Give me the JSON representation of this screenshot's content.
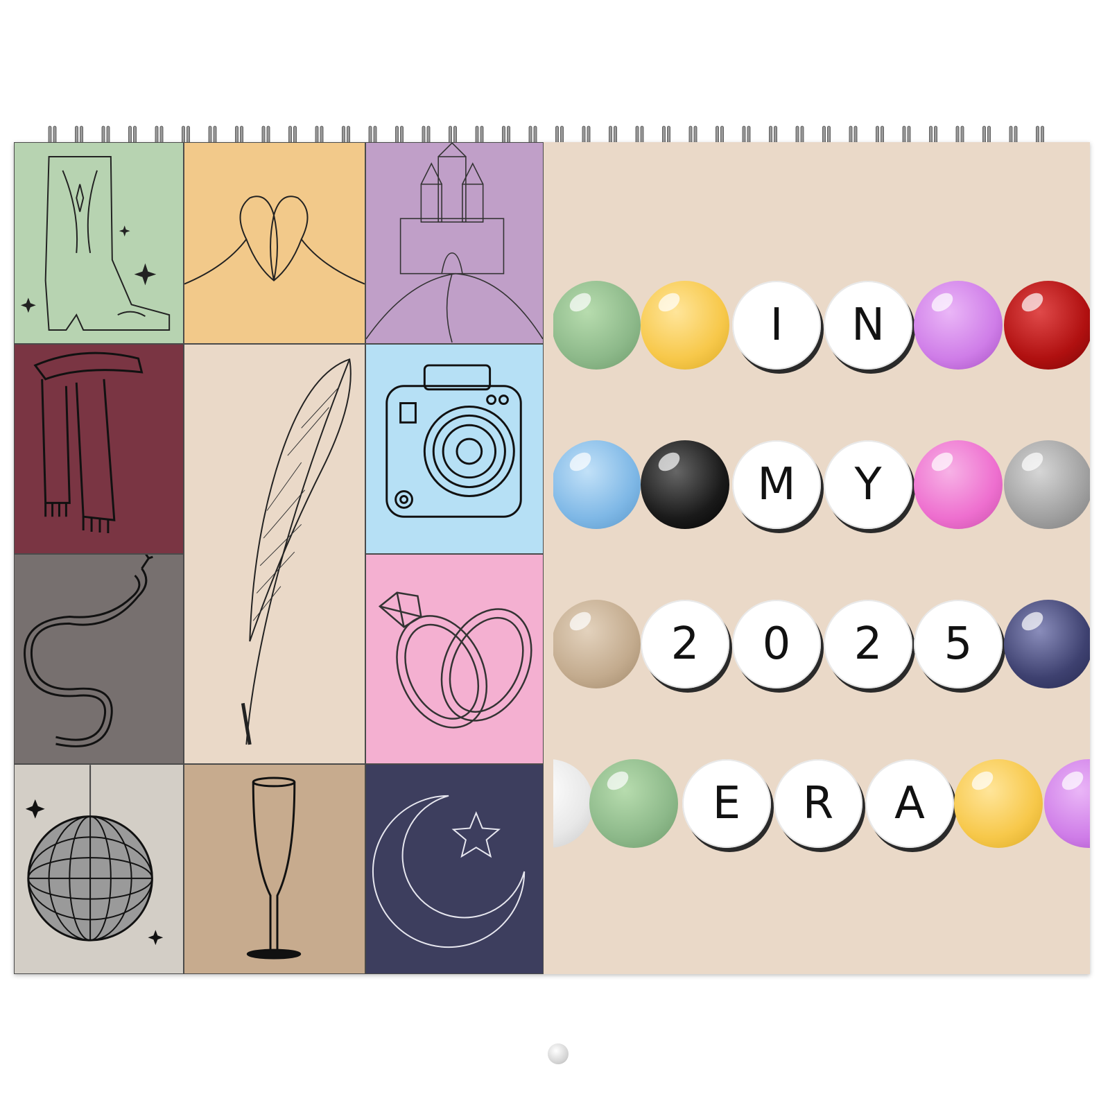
{
  "calendar": {
    "title_words": [
      "IN",
      "MY",
      "2025",
      "ERA"
    ],
    "rows": [
      {
        "letters": [
          "I",
          "N"
        ],
        "color_beads_before": [
          "#8db98a",
          "#f7c84a"
        ],
        "color_beads_after": [
          "#cf7de8",
          "#b01010"
        ]
      },
      {
        "letters": [
          "M",
          "Y"
        ],
        "color_beads_before": [
          "#7fb8e6",
          "#1a1a1a"
        ],
        "color_beads_after": [
          "#ee6fcf",
          "#a0a0a0"
        ]
      },
      {
        "letters": [
          "2",
          "0",
          "2",
          "5"
        ],
        "color_beads_before": [
          "#c3ab8e"
        ],
        "color_beads_after": [
          "#3e4170"
        ]
      },
      {
        "letters": [
          "E",
          "R",
          "A"
        ],
        "color_beads_before": [
          "#e8e8e8",
          "#8db98a"
        ],
        "color_beads_after": [
          "#f7c84a",
          "#cf7de8"
        ]
      }
    ]
  },
  "tiles": [
    {
      "name": "cowboy-boot-icon",
      "color": "#b7d3b1"
    },
    {
      "name": "heart-hands-icon",
      "color": "#f2c98a"
    },
    {
      "name": "castle-icon",
      "color": "#c09fc8"
    },
    {
      "name": "scarf-icon",
      "color": "#7a3543"
    },
    {
      "name": "feather-quill-icon",
      "color": "#ead9c8"
    },
    {
      "name": "instant-camera-icon",
      "color": "#b6e0f5"
    },
    {
      "name": "snake-icon",
      "color": "#77706f"
    },
    {
      "name": "rings-icon",
      "color": "#f4b0d1"
    },
    {
      "name": "disco-ball-icon",
      "color": "#d3cec6"
    },
    {
      "name": "champagne-glass-icon",
      "color": "#c7ab8e"
    },
    {
      "name": "moon-star-icon",
      "color": "#3d3e5e"
    }
  ]
}
